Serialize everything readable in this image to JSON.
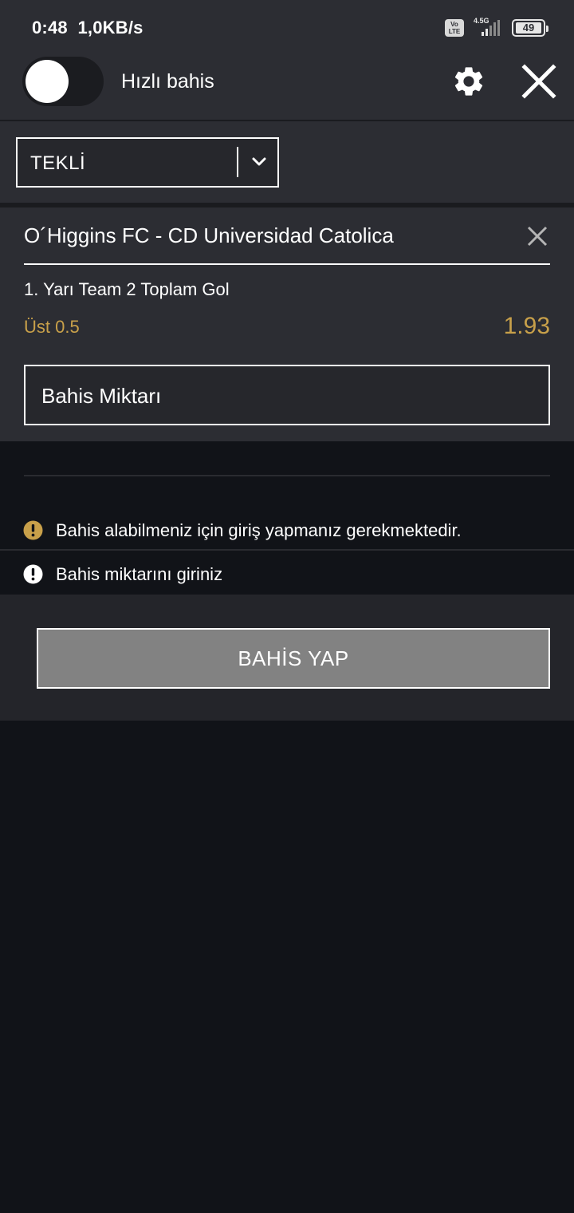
{
  "status_bar": {
    "time": "0:48",
    "speed": "1,0KB/s",
    "volte": "Vo LTE",
    "network": "4.5G",
    "battery": "49"
  },
  "header": {
    "quick_bet_label": "Hızlı bahis",
    "quick_bet_enabled": false,
    "icons": [
      "gear-icon",
      "close-icon"
    ]
  },
  "bet_type": {
    "selected": "TEKLİ"
  },
  "slip": {
    "match": "O´Higgins FC - CD Universidad Catolica",
    "market": "1. Yarı Team 2 Toplam Gol",
    "selection": "Üst 0.5",
    "odds": "1.93",
    "stake_placeholder": "Bahis Miktarı"
  },
  "messages": [
    {
      "text": "Bahis alabilmeniz için giriş yapmanız gerekmektedir.",
      "icon": "warning-icon",
      "color": "#c8a04a"
    },
    {
      "text": "Bahis miktarını giriniz",
      "icon": "alert-icon",
      "color": "#ffffff"
    }
  ],
  "action": {
    "place_bet_label": "BAHİS YAP"
  },
  "colors": {
    "accent": "#c8a04a",
    "panel": "#2c2d33",
    "background": "#111318",
    "button": "#828282"
  }
}
